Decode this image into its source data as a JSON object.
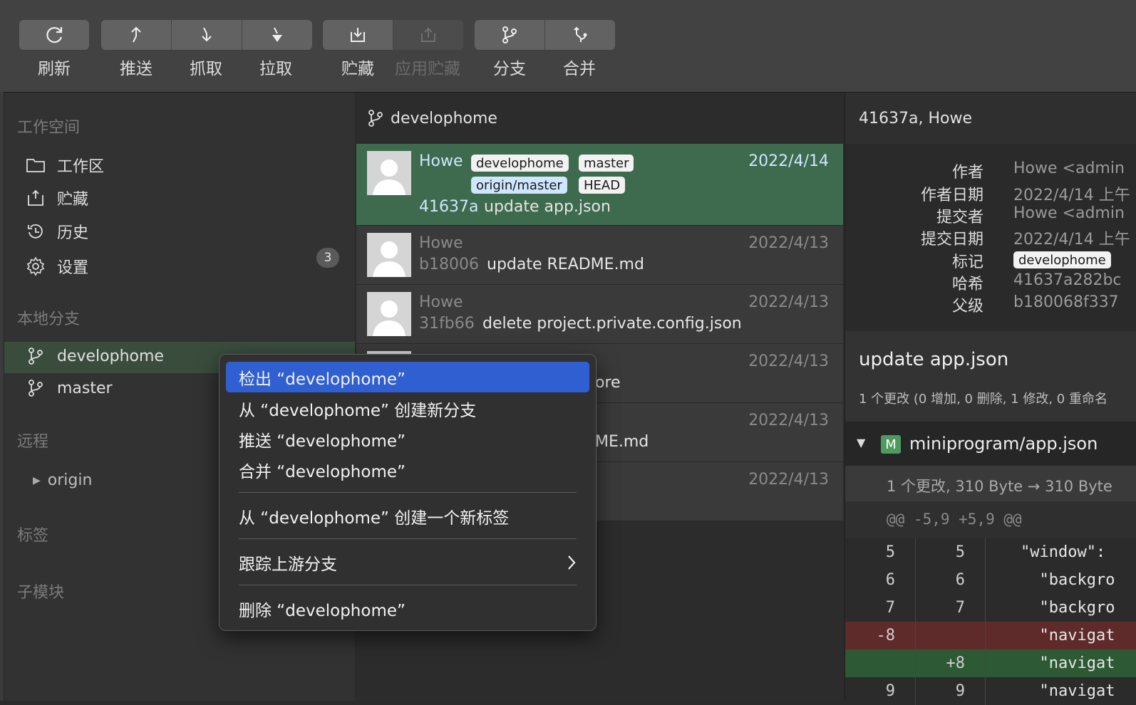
{
  "toolbar": {
    "refresh": "刷新",
    "push": "推送",
    "fetch": "抓取",
    "pull": "拉取",
    "stash": "贮藏",
    "apply_stash": "应用贮藏",
    "branch": "分支",
    "merge": "合并"
  },
  "sidebar": {
    "workspace_title": "工作空间",
    "items": [
      {
        "label": "工作区"
      },
      {
        "label": "贮藏"
      },
      {
        "label": "历史"
      },
      {
        "label": "设置"
      }
    ],
    "worktree_count": "3",
    "local_branches_title": "本地分支",
    "branches": [
      {
        "label": "develophome"
      },
      {
        "label": "master"
      }
    ],
    "remote_title": "远程",
    "remote_origin": "origin",
    "tags_title": "标签",
    "submodules_title": "子模块"
  },
  "commits": {
    "branch": "develophome",
    "rows": [
      {
        "author": "Howe",
        "date": "2022/4/14",
        "hash": "41637a",
        "message": "update app.json",
        "refs": [
          "develophome",
          "master",
          "origin/master",
          "HEAD"
        ]
      },
      {
        "author": "Howe",
        "date": "2022/4/13",
        "hash": "b18006",
        "message": "update README.md"
      },
      {
        "author": "Howe",
        "date": "2022/4/13",
        "hash": "31fb66",
        "message": "delete project.private.config.json"
      },
      {
        "date": "2022/4/13",
        "message_tail": "ore"
      },
      {
        "date": "2022/4/13",
        "message_tail": "ME.md"
      },
      {
        "date": "2022/4/13"
      }
    ]
  },
  "detail": {
    "header": "41637a, Howe",
    "meta": {
      "author_key": "作者",
      "author_val": "Howe <admin",
      "author_date_key": "作者日期",
      "author_date_val": "2022/4/14 上午",
      "committer_key": "提交者",
      "committer_val": "Howe <admin",
      "commit_date_key": "提交日期",
      "commit_date_val": "2022/4/14 上午",
      "tag_key": "标记",
      "tag_val": "develophome",
      "hash_key": "哈希",
      "hash_val": "41637a282bc",
      "parent_key": "父级",
      "parent_val": "b180068f337"
    },
    "title": "update app.json",
    "stats": "1 个更改 (0 增加, 0 删除, 1 修改, 0 重命名",
    "file": {
      "status": "M",
      "path": "miniprogram/app.json"
    },
    "file_sub": "1 个更改, 310 Byte → 310 Byte",
    "hunk": "@@ -5,9 +5,9 @@",
    "lines": [
      {
        "old": "5",
        "new": "5",
        "code": "\"window\": "
      },
      {
        "old": "6",
        "new": "6",
        "code": "  \"backgro"
      },
      {
        "old": "7",
        "new": "7",
        "code": "  \"backgro"
      },
      {
        "old": "-8",
        "new": "",
        "code": "  \"navigat"
      },
      {
        "old": "",
        "new": "+8",
        "code": "  \"navigat"
      },
      {
        "old": "9",
        "new": "9",
        "code": "  \"navigat"
      }
    ]
  },
  "context_menu": {
    "checkout": "检出 “develophome”",
    "new_branch": "从 “develophome” 创建新分支",
    "push": "推送 “develophome”",
    "merge": "合并 “develophome”",
    "new_tag": "从 “develophome” 创建一个新标签",
    "track_upstream": "跟踪上游分支",
    "delete": "删除 “develophome”"
  },
  "colors": {
    "selected_commit": "#3e6b4e",
    "menu_highlight": "#2f5fd0",
    "diff_removed": "#6a2c2c",
    "diff_added": "#2d5a34"
  }
}
